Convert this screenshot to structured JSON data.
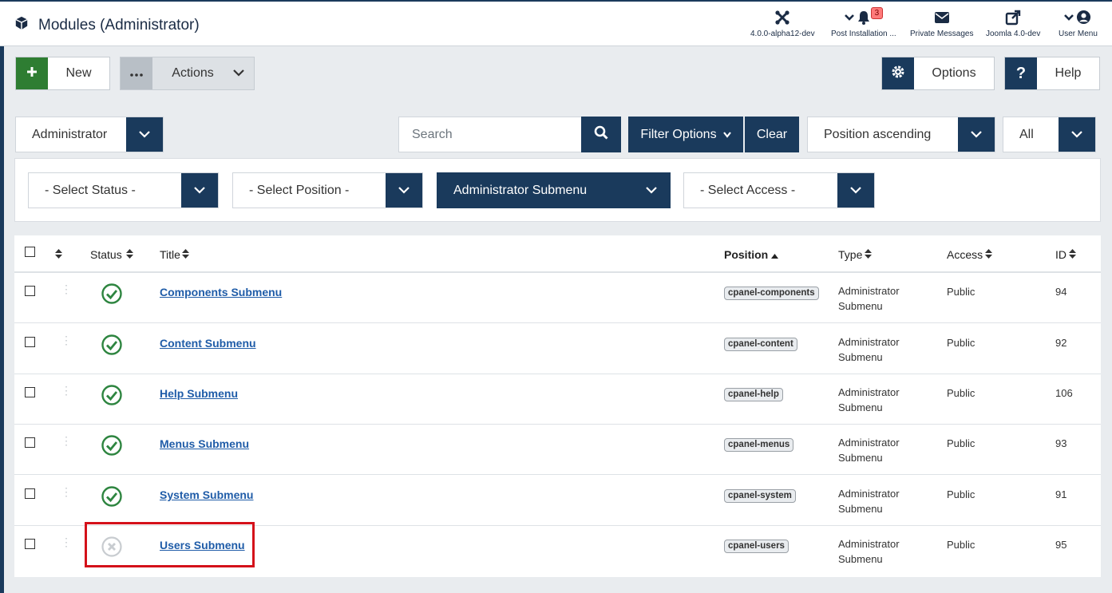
{
  "header": {
    "title": "Modules (Administrator)",
    "items": [
      {
        "label": "4.0.0-alpha12-dev",
        "icon": "joomla-icon"
      },
      {
        "label": "Post Installation ...",
        "icon": "bell-icon",
        "badge": "3"
      },
      {
        "label": "Private Messages",
        "icon": "envelope-icon"
      },
      {
        "label": "Joomla 4.0-dev",
        "icon": "external-link-icon"
      },
      {
        "label": "User Menu",
        "icon": "user-circle-icon"
      }
    ]
  },
  "toolbar": {
    "new_label": "New",
    "actions_label": "Actions",
    "options_label": "Options",
    "help_label": "Help"
  },
  "searchtools": {
    "client_value": "Administrator",
    "search_placeholder": "Search",
    "filter_options_label": "Filter Options",
    "clear_label": "Clear",
    "ordering_value": "Position ascending",
    "limit_value": "All"
  },
  "filters": {
    "status": "- Select Status -",
    "position": "- Select Position -",
    "module": "Administrator Submenu",
    "access": "- Select Access -"
  },
  "table": {
    "headers": {
      "status": "Status",
      "title": "Title",
      "position": "Position",
      "type": "Type",
      "access": "Access",
      "id": "ID"
    },
    "rows": [
      {
        "title": "Components Submenu",
        "position": "cpanel-components",
        "type_line1": "Administrator",
        "type_line2": "Submenu",
        "access": "Public",
        "id": "94",
        "published": true
      },
      {
        "title": "Content Submenu",
        "position": "cpanel-content",
        "type_line1": "Administrator",
        "type_line2": "Submenu",
        "access": "Public",
        "id": "92",
        "published": true
      },
      {
        "title": "Help Submenu",
        "position": "cpanel-help",
        "type_line1": "Administrator",
        "type_line2": "Submenu",
        "access": "Public",
        "id": "106",
        "published": true
      },
      {
        "title": "Menus Submenu",
        "position": "cpanel-menus",
        "type_line1": "Administrator",
        "type_line2": "Submenu",
        "access": "Public",
        "id": "93",
        "published": true
      },
      {
        "title": "System Submenu",
        "position": "cpanel-system",
        "type_line1": "Administrator",
        "type_line2": "Submenu",
        "access": "Public",
        "id": "91",
        "published": true
      },
      {
        "title": "Users Submenu",
        "position": "cpanel-users",
        "type_line1": "Administrator",
        "type_line2": "Submenu",
        "access": "Public",
        "id": "95",
        "published": false
      }
    ]
  },
  "colors": {
    "brand": "#1a3a5c",
    "published": "#2e8540",
    "unpublished": "#c8ccd0",
    "highlight": "#d4111a"
  }
}
